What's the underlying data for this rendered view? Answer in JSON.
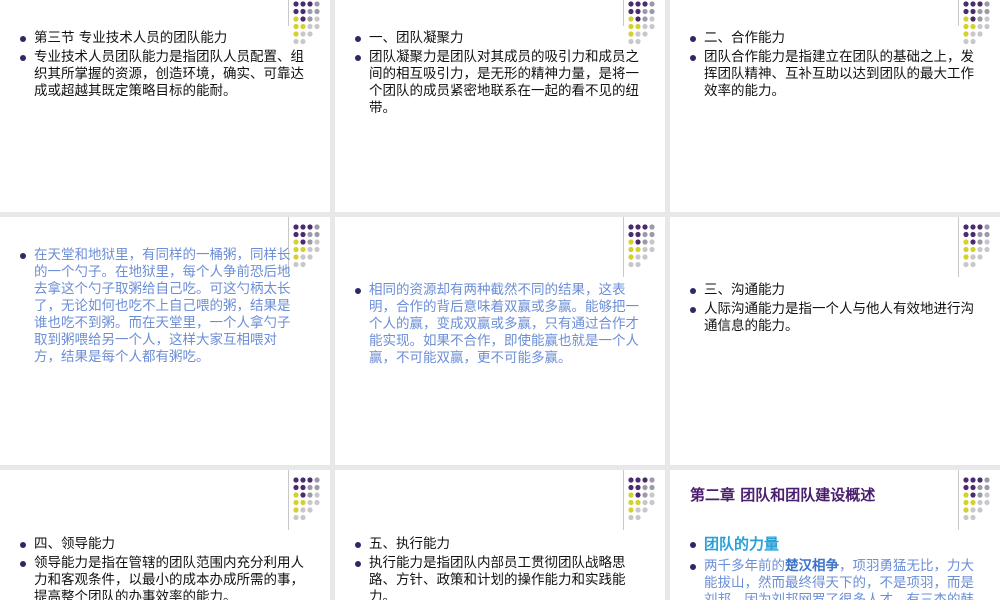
{
  "slides": [
    {
      "id": "s1",
      "items": [
        {
          "text": "第三节  专业技术人员的团队能力",
          "style": "normal"
        },
        {
          "text": "专业技术人员团队能力是指团队人员配置、组织其所掌握的资源，创造环境，确实、可靠达成或超越其既定策略目标的能耐。",
          "style": "normal"
        }
      ]
    },
    {
      "id": "s2",
      "items": [
        {
          "text": "一、团队凝聚力",
          "style": "normal"
        },
        {
          "text": "团队凝聚力是团队对其成员的吸引力和成员之间的相互吸引力，是无形的精神力量，是将一个团队的成员紧密地联系在一起的看不见的纽带。",
          "style": "normal"
        }
      ]
    },
    {
      "id": "s3",
      "items": [
        {
          "text": "二、合作能力",
          "style": "normal"
        },
        {
          "text": "团队合作能力是指建立在团队的基础之上，发挥团队精神、互补互助以达到团队的最大工作效率的能力。",
          "style": "normal"
        }
      ]
    },
    {
      "id": "s4",
      "items": [
        {
          "text": "在天堂和地狱里，有同样的一桶粥，同样长的一个勺子。在地狱里，每个人争前恐后地去拿这个勺子取粥给自己吃。可这勺柄太长了，无论如何也吃不上自己喂的粥，结果是谁也吃不到粥。而在天堂里，一个人拿勺子取到粥喂给另一个人，这样大家互相喂对方，结果是每个人都有粥吃。",
          "style": "blue"
        }
      ]
    },
    {
      "id": "s5",
      "items": [
        {
          "text": "相同的资源却有两种截然不同的结果，这表明，合作的背后意味着双赢或多赢。能够把一个人的赢，变成双赢或多赢，只有通过合作才能实现。如果不合作，即使能赢也就是一个人赢，不可能双赢，更不可能多赢。",
          "style": "blue"
        }
      ]
    },
    {
      "id": "s6",
      "items": [
        {
          "text": "三、沟通能力",
          "style": "normal"
        },
        {
          "text": "人际沟通能力是指一个人与他人有效地进行沟通信息的能力。",
          "style": "normal"
        }
      ]
    },
    {
      "id": "s7",
      "items": [
        {
          "text": "四、领导能力",
          "style": "normal"
        },
        {
          "text": "领导能力是指在管辖的团队范围内充分利用人力和客观条件，以最小的成本办成所需的事，提高整个团队的办事效率的能力。",
          "style": "normal"
        }
      ]
    },
    {
      "id": "s8",
      "items": [
        {
          "text": "五、执行能力",
          "style": "normal"
        },
        {
          "text": "执行能力是指团队内部员工贯彻团队战略思路、方针、政策和计划的操作能力和实践能力。",
          "style": "normal"
        }
      ]
    },
    {
      "id": "s9",
      "chapter_title": "第二章  团队和团队建设概述",
      "strength_title": "团队的力量",
      "strength_body_pre": "两千多年前的",
      "strength_body_bold": "楚汉相争",
      "strength_body_post": "，项羽勇猛无比，力大能拔山，然而最终得天下的，不是项羽，而是刘邦。因为刘邦网罗了很多人才，有三杰的韩信、张良、萧何。"
    }
  ],
  "colors": {
    "background": "#e8e8e8",
    "slide": "#ffffff",
    "bullet": "#2a2a66",
    "blue_text": "#6b8ed6",
    "chapter_title": "#4a1e6e",
    "strength_title": "#2aa0d8",
    "dot_purple": "#4b2a6e",
    "dot_gray": "#9a9aa8",
    "dot_yellow": "#d4d02c",
    "dot_lightgray": "#c8c8cc"
  },
  "icons": {
    "decoration": "dot-grid-icon",
    "bullet": "bullet-dot-icon"
  }
}
